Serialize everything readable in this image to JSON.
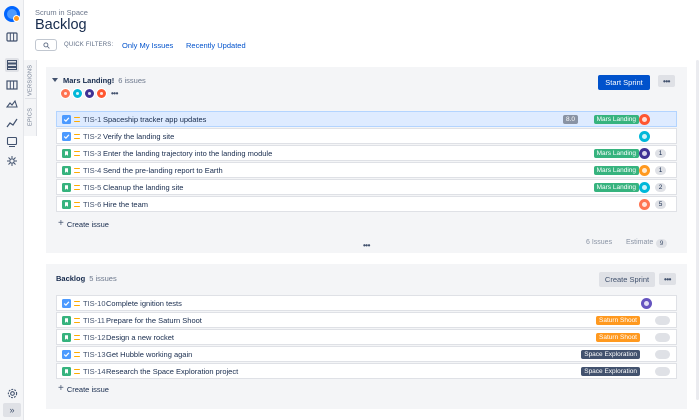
{
  "header": {
    "breadcrumb": "Scrum in Space",
    "title": "Backlog",
    "quick_filters_label": "QUICK FILTERS:",
    "filters": [
      "Only My Issues",
      "Recently Updated"
    ]
  },
  "side_tabs": [
    "VERSIONS",
    "EPICS"
  ],
  "colors": {
    "primary": "#0052cc",
    "epic_mars_landing": "#36b37e",
    "epic_saturn_shoot": "#ff991f",
    "epic_space_exploration": "#42526e",
    "selected_row": "#deebff"
  },
  "sprint": {
    "name": "Mars Landing!",
    "count": "6 issues",
    "start_button": "Start Sprint",
    "more": "•••",
    "avatars": [
      "#ff7452",
      "#00b8d9",
      "#403294",
      "#ff5630"
    ],
    "avatars_more": "•••",
    "create_issue": "Create issue",
    "summary_issues": "6 Issues",
    "summary_estimate_label": "Estimate",
    "summary_estimate_value": "9",
    "issues": [
      {
        "key": "TIS-1",
        "summary": "Spaceship tracker app updates",
        "type": "task",
        "estimate": "8.0",
        "epic": "Mars Landing",
        "epic_color": "#36b37e",
        "avatar": "#ff5630",
        "points": "",
        "selected": true
      },
      {
        "key": "TIS-2",
        "summary": "Verify the landing site",
        "type": "task",
        "estimate": "",
        "epic": "",
        "epic_color": "",
        "avatar": "#00b8d9",
        "points": "",
        "selected": false
      },
      {
        "key": "TIS-3",
        "summary": "Enter the landing trajectory into the landing module",
        "type": "story",
        "estimate": "",
        "epic": "Mars Landing",
        "epic_color": "#36b37e",
        "avatar": "#403294",
        "points": "1",
        "selected": false
      },
      {
        "key": "TIS-4",
        "summary": "Send the pre-landing report to Earth",
        "type": "story",
        "estimate": "",
        "epic": "Mars Landing",
        "epic_color": "#36b37e",
        "avatar": "#ff991f",
        "points": "1",
        "selected": false
      },
      {
        "key": "TIS-5",
        "summary": "Cleanup the landing site",
        "type": "story",
        "estimate": "",
        "epic": "Mars Landing",
        "epic_color": "#36b37e",
        "avatar": "#00b8d9",
        "points": "2",
        "selected": false
      },
      {
        "key": "TIS-6",
        "summary": "Hire the team",
        "type": "story",
        "estimate": "",
        "epic": "",
        "epic_color": "",
        "avatar": "#ff7452",
        "points": "5",
        "selected": false
      }
    ]
  },
  "backlog": {
    "name": "Backlog",
    "count": "5 issues",
    "create_sprint_button": "Create Sprint",
    "more": "•••",
    "create_issue": "Create issue",
    "issues": [
      {
        "key": "TIS-10",
        "summary": "Complete ignition tests",
        "type": "task",
        "epic": "",
        "epic_color": "",
        "avatar": "#6554c0",
        "points": ""
      },
      {
        "key": "TIS-11",
        "summary": "Prepare for the Saturn Shoot",
        "type": "story",
        "epic": "Saturn Shoot",
        "epic_color": "#ff991f",
        "avatar": "",
        "points": "empty"
      },
      {
        "key": "TIS-12",
        "summary": "Design a new rocket",
        "type": "story",
        "epic": "Saturn Shoot",
        "epic_color": "#ff991f",
        "avatar": "",
        "points": "empty"
      },
      {
        "key": "TIS-13",
        "summary": "Get Hubble working again",
        "type": "task",
        "epic": "Space Exploration",
        "epic_color": "#42526e",
        "avatar": "",
        "points": "empty"
      },
      {
        "key": "TIS-14",
        "summary": "Research the Space Exploration project",
        "type": "story",
        "epic": "Space Exploration",
        "epic_color": "#42526e",
        "avatar": "",
        "points": "empty"
      }
    ]
  }
}
